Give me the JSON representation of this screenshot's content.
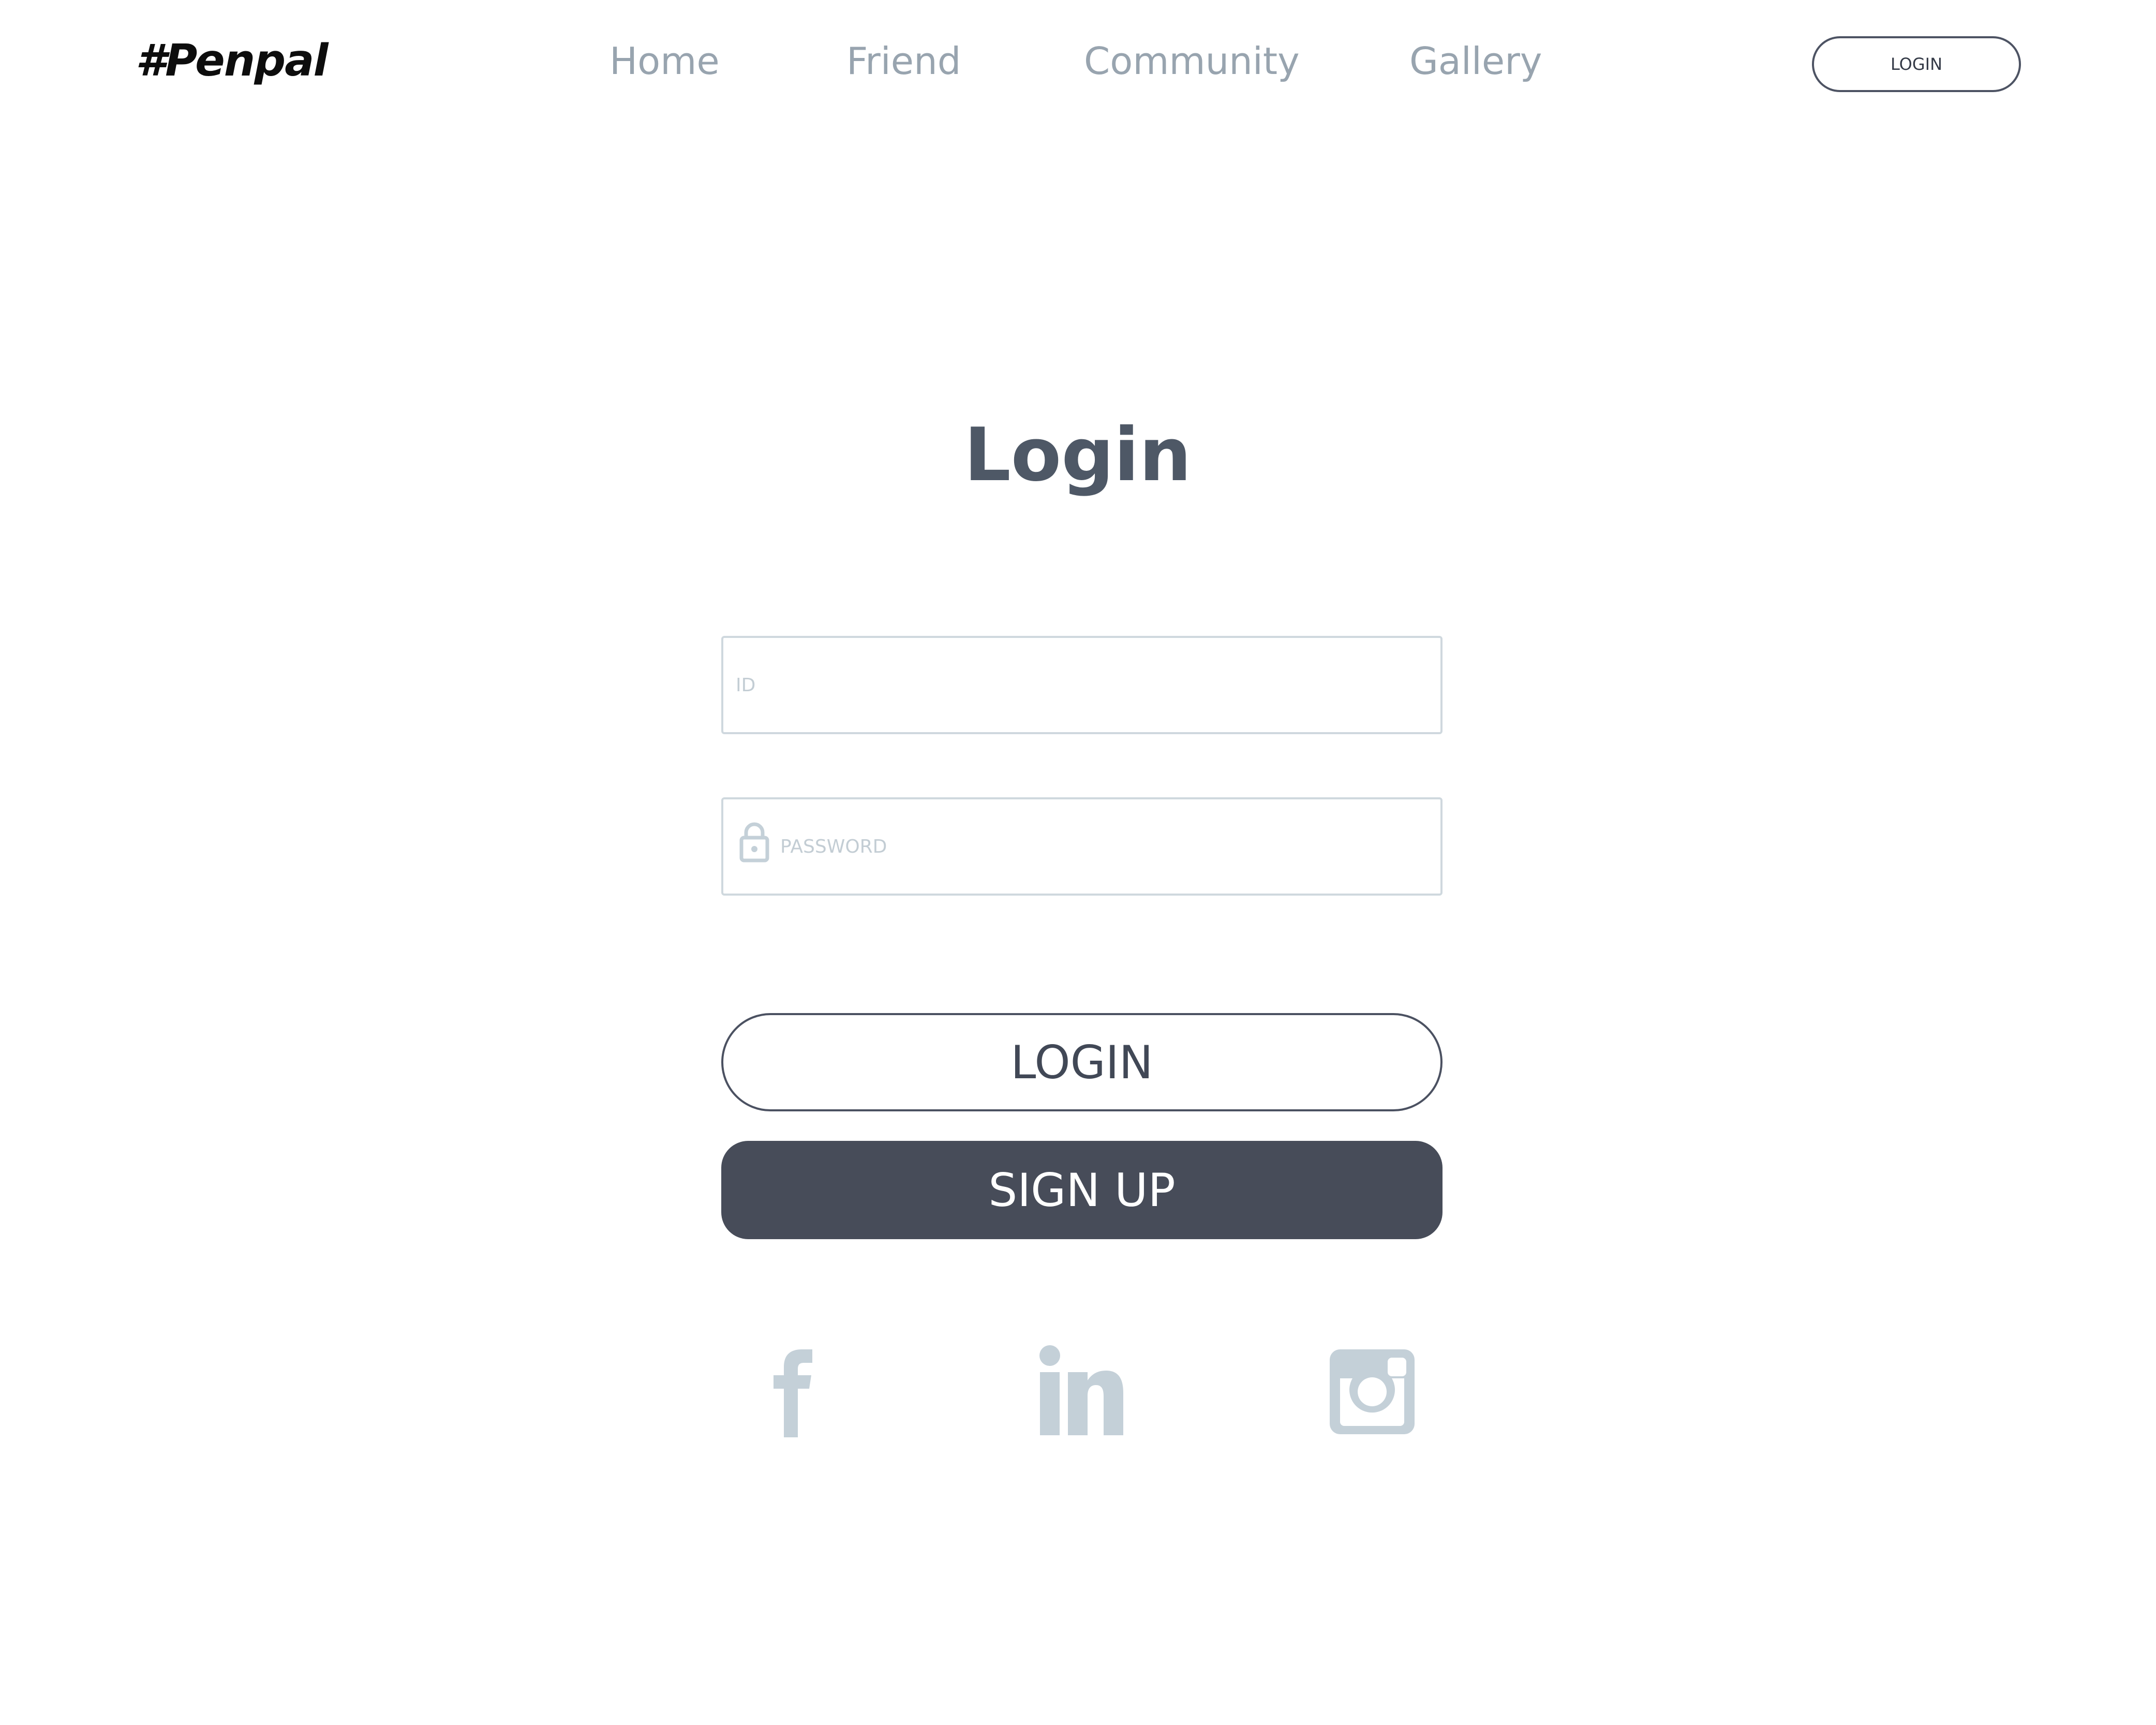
{
  "header": {
    "logo": "#Penpal",
    "nav": [
      "Home",
      "Friend",
      "Community",
      "Gallery"
    ],
    "login_label": "LOGIN"
  },
  "main": {
    "title": "Login",
    "id_placeholder": "ID",
    "password_placeholder": "PASSWORD",
    "login_button": "LOGIN",
    "signup_button": "SIGN UP"
  },
  "social": [
    "facebook-icon",
    "linkedin-icon",
    "instagram-icon"
  ],
  "colors": {
    "primary_dark": "#474c59",
    "nav_text": "#98a4af",
    "title_text": "#4e5866",
    "field_border": "#cfd8de",
    "social_icon": "#c4d0d8"
  }
}
